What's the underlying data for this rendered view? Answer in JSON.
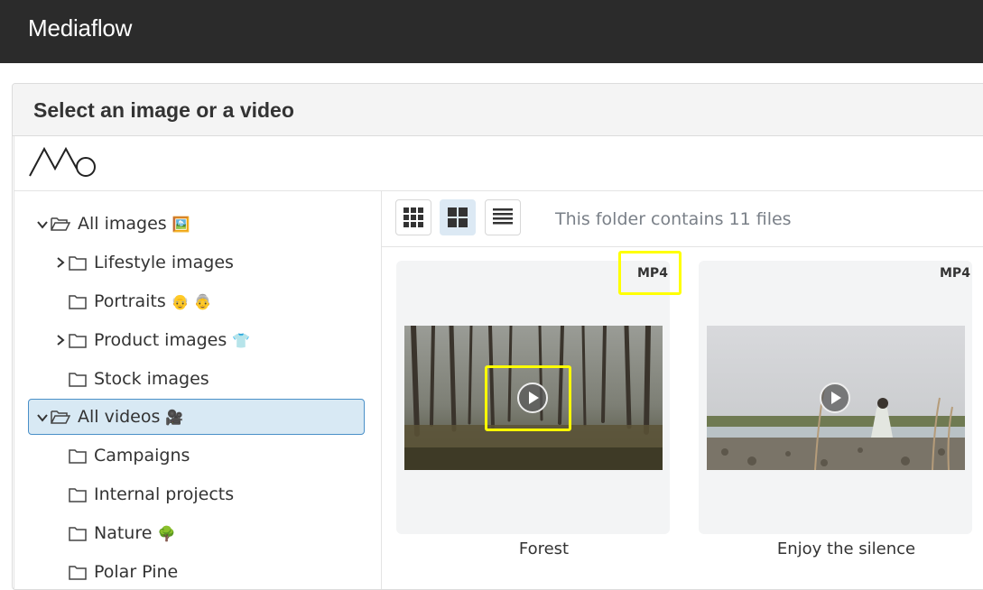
{
  "app": {
    "title": "Mediaflow"
  },
  "dialog": {
    "title": "Select an image or a video"
  },
  "tree": {
    "items": [
      {
        "label": "All images",
        "emoji": "🖼️",
        "expanded": true
      },
      {
        "label": "Lifestyle images",
        "emoji": "",
        "collapsed": true
      },
      {
        "label": "Portraits",
        "emoji": "👴 👵"
      },
      {
        "label": "Product images",
        "emoji": "👕",
        "collapsed": true
      },
      {
        "label": "Stock images",
        "emoji": ""
      },
      {
        "label": "All videos",
        "emoji": "🎥",
        "expanded": true,
        "selected": true
      },
      {
        "label": "Campaigns",
        "emoji": ""
      },
      {
        "label": "Internal projects",
        "emoji": ""
      },
      {
        "label": "Nature",
        "emoji": "🌳"
      },
      {
        "label": "Polar Pine",
        "emoji": ""
      }
    ]
  },
  "toolbar": {
    "views": [
      "small-grid-view",
      "large-grid-view",
      "list-view"
    ],
    "active_view": "large-grid-view",
    "folder_count_text": "This folder contains 11 files"
  },
  "files": [
    {
      "name": "Forest",
      "format": "MP4"
    },
    {
      "name": "Enjoy the silence",
      "format": "MP4"
    }
  ],
  "colors": {
    "topbar": "#2b2b2b",
    "selected_bg": "#d8e9f4",
    "selected_border": "#4a90c8",
    "highlight": "#ffff00"
  }
}
